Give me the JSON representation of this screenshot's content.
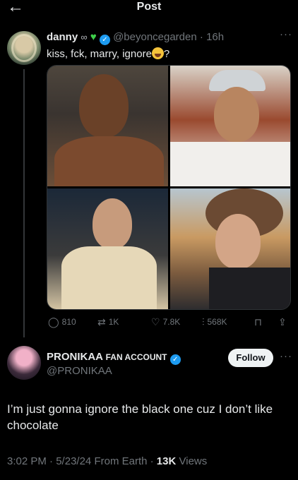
{
  "header": {
    "title": "Post",
    "back_icon": "arrow-left-icon"
  },
  "post": {
    "display_name": "danny",
    "handle": "@beyoncegarden",
    "time": "16h",
    "text": "kiss, fck, marry, ignore",
    "text_suffix": "?",
    "more": "···",
    "stats": {
      "replies": "810",
      "reposts": "1K",
      "likes": "7.8K",
      "views": "568K"
    },
    "images": [
      {
        "alt": "shirtless man with shaved head"
      },
      {
        "alt": "man with cap and curly hair making peace sign"
      },
      {
        "alt": "man holding a drink with straw"
      },
      {
        "alt": "man with wavy hair pointing at camera"
      }
    ]
  },
  "reply": {
    "display_name": "PRONIKAA",
    "fan_label": "FAN ACCOUNT",
    "handle": "@PRONIKAA",
    "follow_label": "Follow",
    "more": "···",
    "text": "I’m just gonna ignore the black one cuz I don’t like chocolate",
    "time": "3:02 PM",
    "date": "5/23/24",
    "source": "From Earth",
    "views_count": "13K",
    "views_label": "Views"
  },
  "colors": {
    "accent": "#1d9bf0",
    "heart": "#3ecf4a",
    "muted": "#71767b"
  }
}
